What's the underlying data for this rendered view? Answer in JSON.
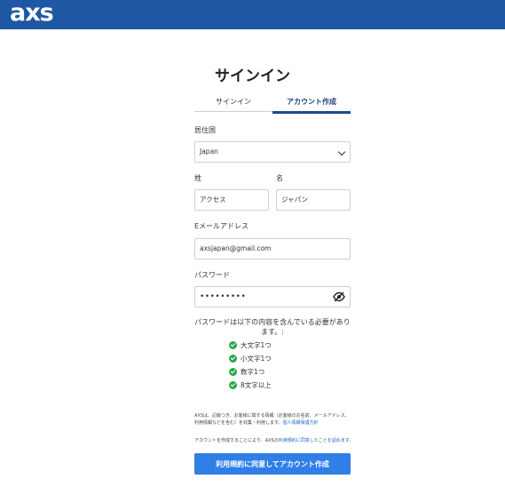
{
  "header": {
    "logo_text": "axs"
  },
  "page": {
    "title": "サインイン"
  },
  "tabs": [
    {
      "label": "サインイン",
      "active": false
    },
    {
      "label": "アカウント作成",
      "active": true
    }
  ],
  "form": {
    "country": {
      "label": "居住国",
      "value": "Japan"
    },
    "last_name": {
      "label": "姓",
      "value": "アクセス"
    },
    "first_name": {
      "label": "名",
      "value": "ジャパン"
    },
    "email": {
      "label": "Eメールアドレス",
      "value": "axsjapan@gmail.com"
    },
    "password": {
      "label": "パスワード",
      "value": "•••••••••"
    }
  },
  "password_requirements": {
    "title": "パスワードは以下の内容を含んでいる必要があります。:",
    "items": [
      {
        "text": "大文字1つ",
        "met": true
      },
      {
        "text": "小文字1つ",
        "met": true
      },
      {
        "text": "数字1つ",
        "met": true
      },
      {
        "text": "8文字以上",
        "met": true
      }
    ]
  },
  "legal": {
    "privacy_text": "AXSは、記録つき、お客様に関する情報（お客様のお名前、メールアドレス、利用情報などを含む）を収集・利用します。",
    "privacy_link": "個人情報保護方針",
    "terms_prefix": "アカウントを作成することにより、AXSの",
    "terms_link": "利用規約に同意したことを認めます。"
  },
  "submit_label": "利用規約に同意してアカウント作成",
  "colors": {
    "header_bg": "#1f57a4",
    "primary_button": "#2f7fe6",
    "active_tab": "#1f4a8c",
    "check_green": "#2aa84a"
  }
}
